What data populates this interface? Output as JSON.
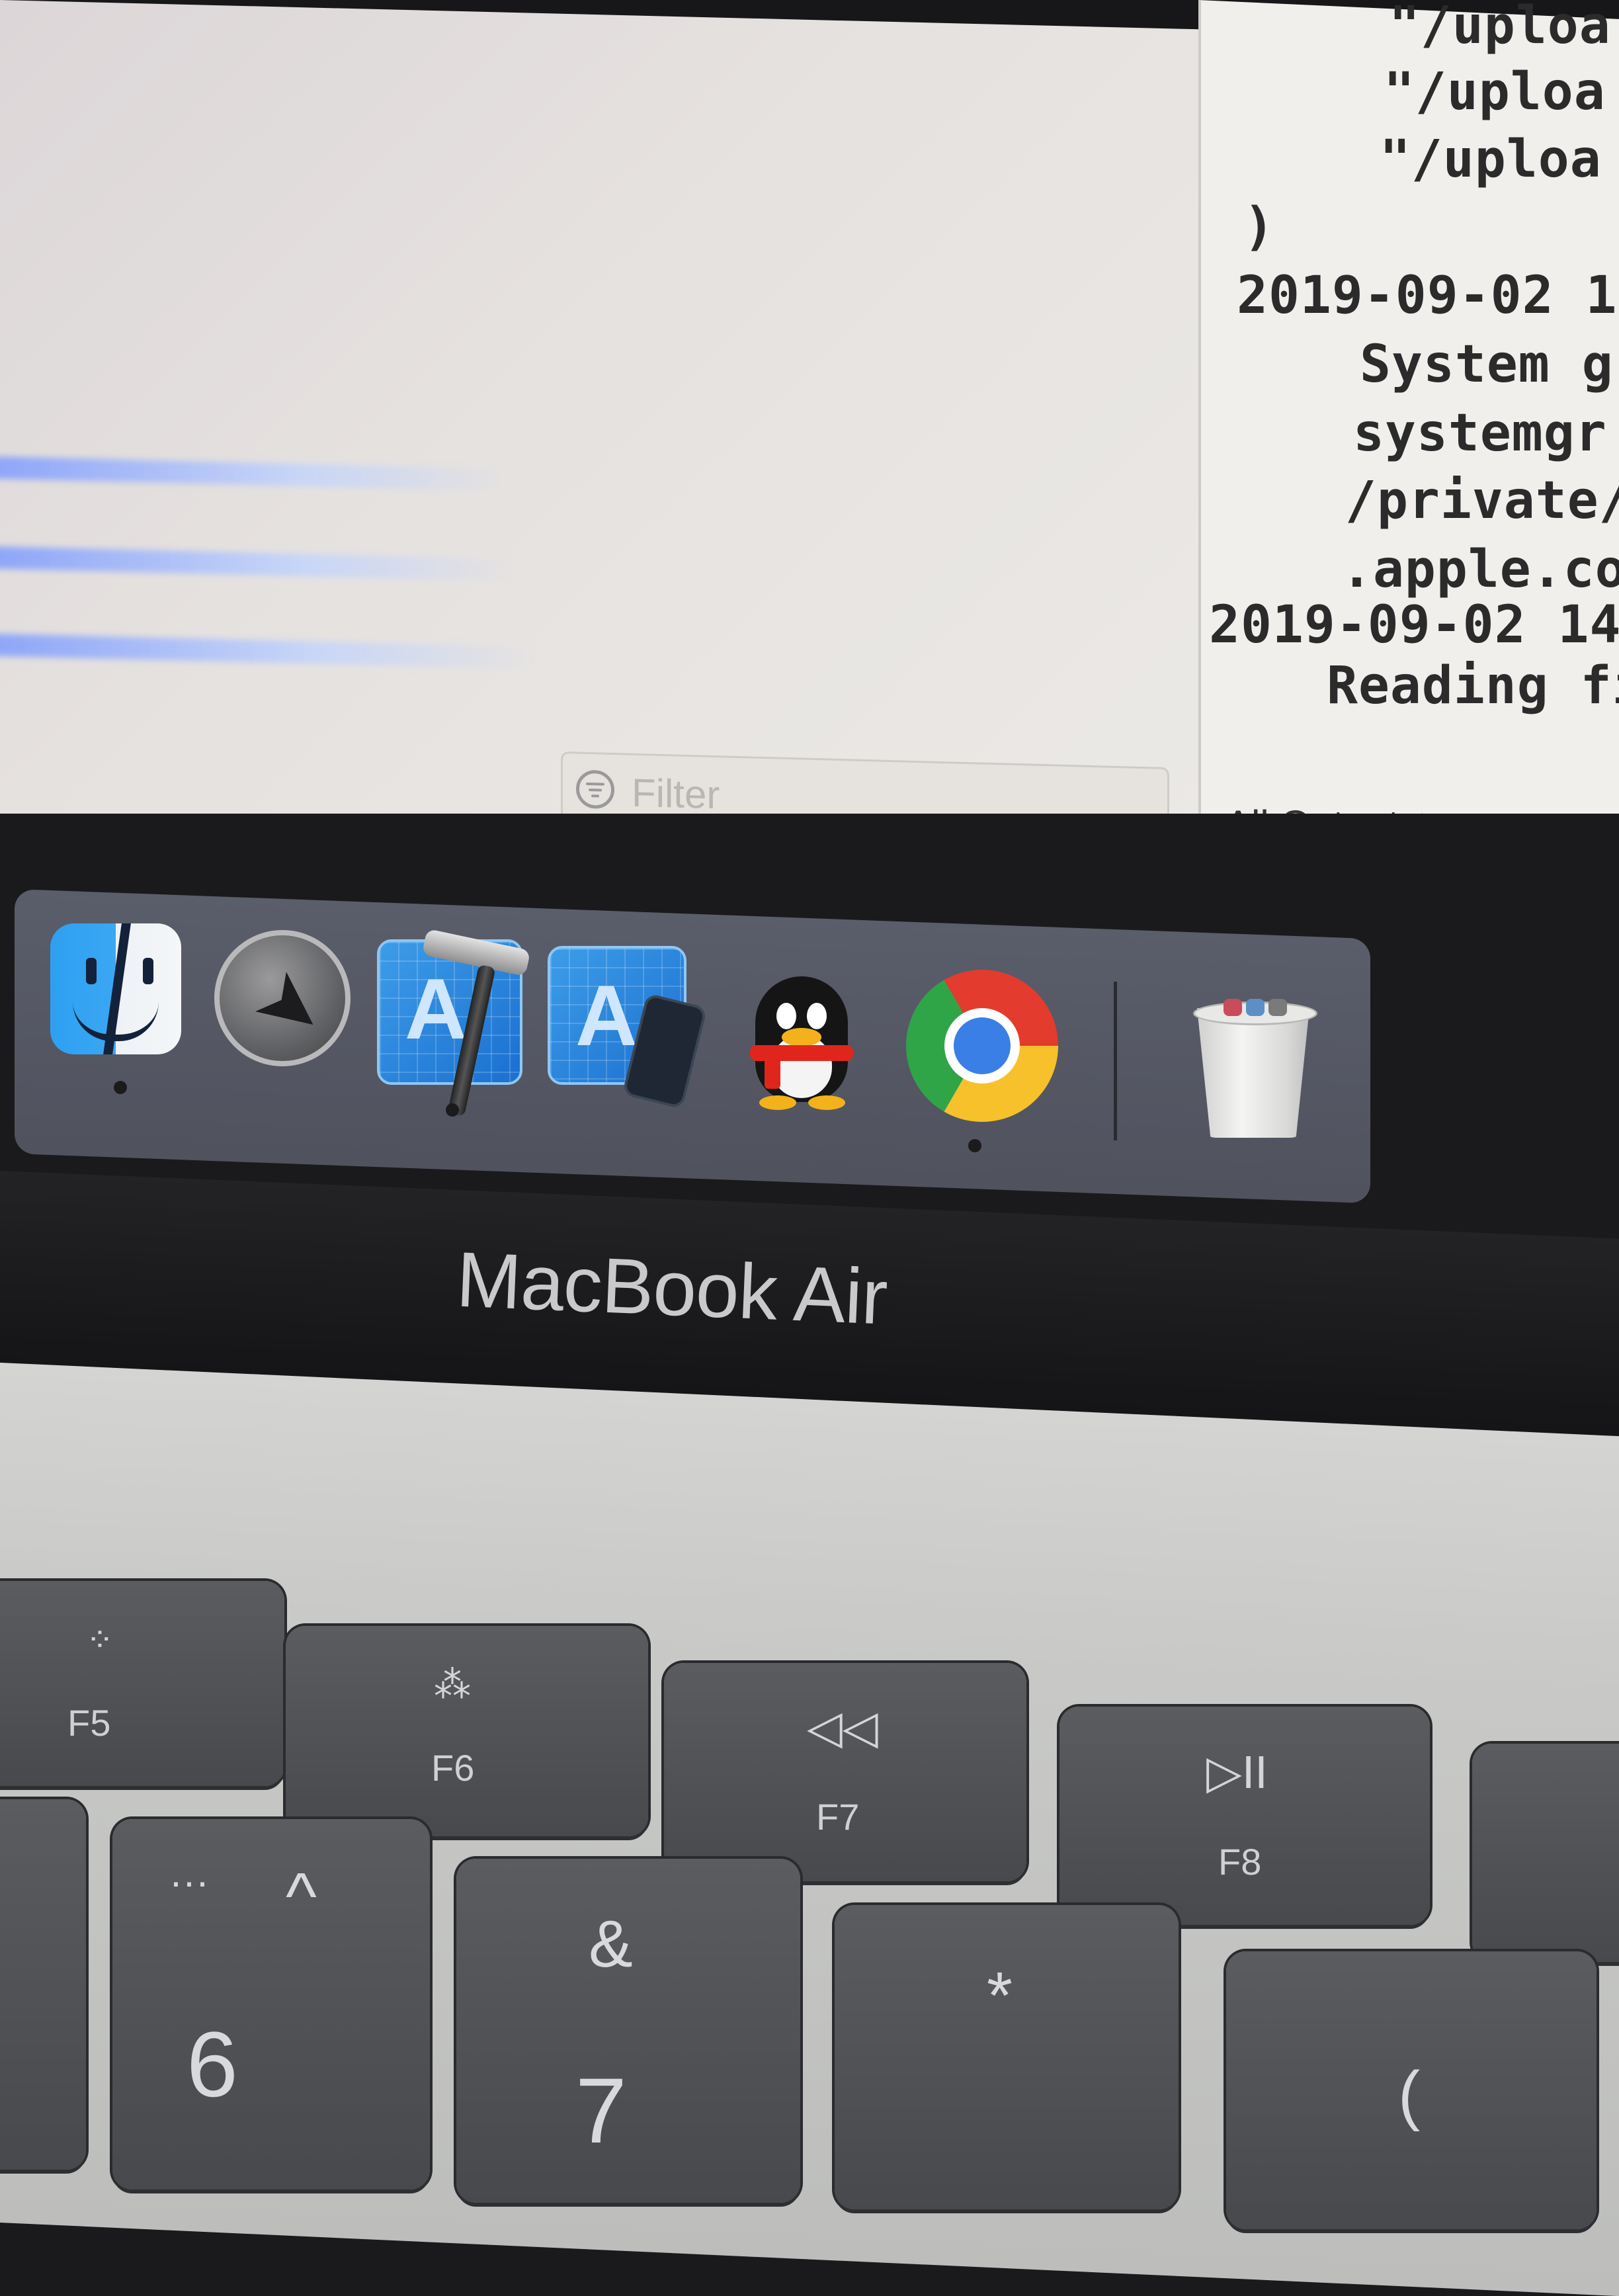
{
  "console": {
    "lines": [
      "\"/uploa",
      "\"/uploa",
      "\"/uploa",
      ")",
      "2019-09-02 1",
      "System g",
      "systemgr",
      "/private/",
      ".apple.co",
      "2019-09-02 14",
      "Reading fi"
    ],
    "output_selector": "All Output"
  },
  "filter": {
    "placeholder": "Filter"
  },
  "dock": {
    "apps": [
      {
        "name": "Finder",
        "icon": "finder-icon",
        "running": true
      },
      {
        "name": "Launchpad",
        "icon": "launchpad-icon",
        "running": false
      },
      {
        "name": "Xcode",
        "icon": "xcode-icon",
        "running": true
      },
      {
        "name": "Simulator",
        "icon": "simulator-icon",
        "running": false
      },
      {
        "name": "QQ",
        "icon": "qq-penguin-icon",
        "running": false
      },
      {
        "name": "Google Chrome",
        "icon": "chrome-icon",
        "running": true
      },
      {
        "name": "Trash",
        "icon": "trash-icon",
        "running": false
      }
    ]
  },
  "bezel": {
    "label": "MacBook Air"
  },
  "keyboard": {
    "fn_keys": [
      {
        "label": "F5",
        "icon": "keyboard-brightness-down-icon"
      },
      {
        "label": "F6",
        "icon": "keyboard-brightness-up-icon"
      },
      {
        "label": "F7",
        "icon": "rewind-icon",
        "glyph": "◁◁"
      },
      {
        "label": "F8",
        "icon": "play-pause-icon",
        "glyph": "▷II"
      }
    ],
    "number_keys": [
      {
        "main": "6",
        "shift": "^"
      },
      {
        "main": "7",
        "shift": "&"
      },
      {
        "main": "",
        "shift": "*"
      },
      {
        "main": "",
        "shift": "("
      }
    ]
  },
  "colors": {
    "dock_bg": "#55575f",
    "key_bg": "#4f5155",
    "screen_left": "#e5e1df",
    "screen_right": "#f1efec"
  }
}
